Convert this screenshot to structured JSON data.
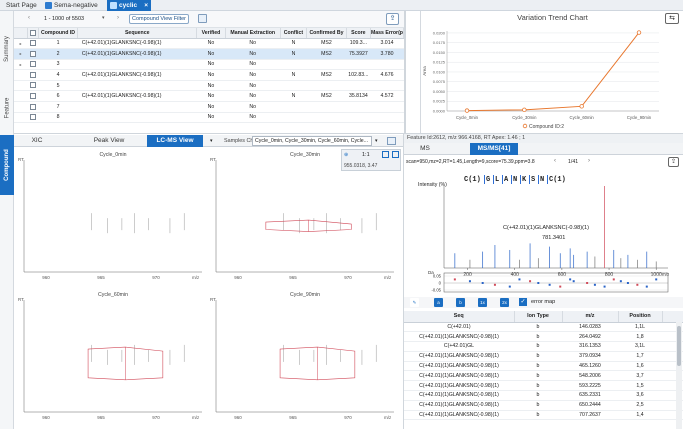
{
  "tabs": [
    {
      "label": "Start Page"
    },
    {
      "label": "Sema-negative"
    },
    {
      "label": "cyclic"
    }
  ],
  "side_tabs": [
    "Summary",
    "Feature",
    "Compound"
  ],
  "toolbar": {
    "range_label": "1 - 1000 of 5503",
    "filter_button": "Compound View Filter"
  },
  "grid": {
    "headers": [
      "",
      "",
      "Compound ID",
      "Sequence",
      "Verified",
      "Manual Extraction",
      "Conflict",
      "Confirmed By",
      "Score",
      "Mass Error(p"
    ],
    "rows": [
      [
        "1",
        "C(+42.01)(1)GLANKSNC(-0.98)(1)",
        "No",
        "No",
        "N",
        "MS2",
        "109.3...",
        "3.014"
      ],
      [
        "2",
        "C(+42.01)(1)GLANKSNC(-0.98)(1)",
        "No",
        "No",
        "N",
        "MS2",
        "75.3927",
        "3.780"
      ],
      [
        "3",
        "",
        "No",
        "No",
        "",
        "",
        "",
        ""
      ],
      [
        "4",
        "C(+42.01)(1)GLANKSNC(-0.98)(1)",
        "No",
        "No",
        "N",
        "MS2",
        "102.83...",
        "4.676"
      ],
      [
        "5",
        "",
        "No",
        "No",
        "",
        "",
        "",
        ""
      ],
      [
        "6",
        "C(+42.01)(1)GLANKSNC(-0.98)(1)",
        "No",
        "No",
        "N",
        "MS2",
        "35.8134",
        "4.572"
      ],
      [
        "7",
        "",
        "No",
        "No",
        "",
        "",
        "",
        ""
      ],
      [
        "8",
        "",
        "No",
        "No",
        "",
        "",
        "",
        ""
      ]
    ],
    "row_count_label": "8"
  },
  "trend_chart": {
    "title": "Variation Trend Chart",
    "y_axis_label": "Area",
    "legend": "Compound ID:2",
    "chart_data": {
      "type": "line",
      "title": "Variation Trend Chart",
      "xlabel": "",
      "ylabel": "Area",
      "categories": [
        "Cycle_0min",
        "Cycle_30min",
        "Cycle_60min",
        "Cycle_90min"
      ],
      "series": [
        {
          "name": "Compound ID:2",
          "values": [
            0.0001,
            0.0003,
            0.0012,
            0.0201
          ]
        }
      ],
      "y_ticks": [
        "0.0000",
        "0.0025",
        "0.0050",
        "0.0075",
        "0.0100",
        "0.0125",
        "0.0150",
        "0.0175",
        "0.0200"
      ],
      "ylim": [
        0,
        0.0205
      ],
      "color": "#e8772e"
    }
  },
  "view_tabs": [
    "XIC",
    "Peak View",
    "LC-MS View"
  ],
  "samples": {
    "label": "Samples Cho...",
    "value": "Cycle_0min, Cycle_30min, Cycle_60min, Cycle..."
  },
  "zoom": {
    "ratio": "1:1",
    "coord": "955.0318, 3.47"
  },
  "lcms_panels": [
    {
      "title": "Cycle_0min",
      "x_ticks": [
        "960",
        "965",
        "970"
      ],
      "y_label": "RT",
      "x_unit": "m/z"
    },
    {
      "title": "Cycle_30min",
      "x_ticks": [
        "960",
        "965",
        "970"
      ],
      "y_label": "RT",
      "x_unit": "m/z"
    },
    {
      "title": "Cycle_60min",
      "x_ticks": [
        "960",
        "965",
        "970"
      ],
      "y_label": "RT",
      "x_unit": "m/z"
    },
    {
      "title": "Cycle_90min",
      "x_ticks": [
        "960",
        "965",
        "970"
      ],
      "y_label": "RT",
      "x_unit": "m/z"
    }
  ],
  "feature_info": "Feature Id:2612, m/z 966.4168, RT Apex: 1.46 ; 1",
  "ms_tabs": [
    "MS",
    "MS/MS[41]"
  ],
  "spectrum": {
    "scan_info": "scan=950,mz=2,RT=1.45,Length=9,score=75.39,ppm=3.8",
    "page": "1/41",
    "y_label": "Intensity (%)",
    "sequence": [
      "C(1)",
      "G",
      "L",
      "A",
      "N",
      "K",
      "S",
      "N",
      "C(1)"
    ],
    "peptide": "C(+42.01)(1)GLANKSNC(-0.98)(1)",
    "mz_value": "781.3401",
    "x_ticks": [
      "200",
      "400",
      "600",
      "800",
      "1000"
    ],
    "x_unit": "m/z",
    "error_label": "Da",
    "error_ticks": [
      "0.05",
      "0",
      "-0.05"
    ]
  },
  "tool_buttons": [
    "a",
    "b",
    "1x",
    "2x",
    "3y"
  ],
  "error_map_label": "error map",
  "fragments": {
    "headers": [
      "Seq",
      "Ion Type",
      "m/z",
      "Position"
    ],
    "rows": [
      [
        "C(+42.01)",
        "b",
        "146.0283",
        "1,1L"
      ],
      [
        "C(+42.01)(1)GLANKSNC(-0.98)(1)",
        "b",
        "264.0492",
        "1,8"
      ],
      [
        "C(+42.01)GL",
        "b",
        "316.1353",
        "3,1L"
      ],
      [
        "C(+42.01)(1)GLANKSNC(-0.98)(1)",
        "b",
        "379.0934",
        "1,7"
      ],
      [
        "C(+42.01)(1)GLANKSNC(-0.98)(1)",
        "b",
        "465.1260",
        "1,6"
      ],
      [
        "C(+42.01)(1)GLANKSNC(-0.98)(1)",
        "b",
        "548.2006",
        "3,7"
      ],
      [
        "C(+42.01)(1)GLANKSNC(-0.98)(1)",
        "b",
        "593.2225",
        "1,5"
      ],
      [
        "C(+42.01)(1)GLANKSNC(-0.98)(1)",
        "b",
        "635.2331",
        "3,6"
      ],
      [
        "C(+42.01)(1)GLANKSNC(-0.98)(1)",
        "b",
        "650.2444",
        "2,5"
      ],
      [
        "C(+42.01)(1)GLANKSNC(-0.98)(1)",
        "b",
        "707.2637",
        "1,4"
      ]
    ]
  }
}
